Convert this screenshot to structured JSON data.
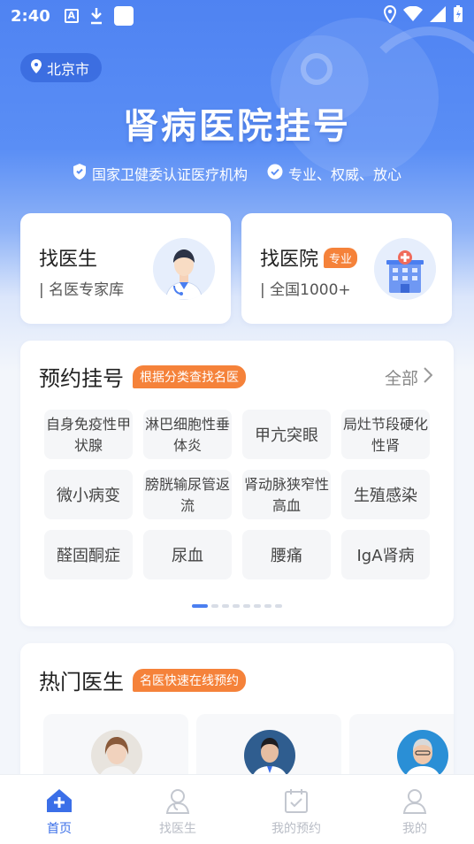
{
  "status_bar": {
    "time": "2:40"
  },
  "location": {
    "city": "北京市"
  },
  "hero": {
    "title": "肾病医院挂号",
    "tags": [
      "国家卫健委认证医疗机构",
      "专业、权威、放心"
    ]
  },
  "quick_cards": [
    {
      "title": "找医生",
      "subtitle": "| 名医专家库",
      "badge": ""
    },
    {
      "title": "找医院",
      "subtitle": "| 全国1000+",
      "badge": "专业"
    }
  ],
  "appointment": {
    "title": "预约挂号",
    "badge": "根据分类查找名医",
    "more": "全部",
    "categories": [
      "自身免疫性甲状腺",
      "淋巴细胞性垂体炎",
      "甲亢突眼",
      "局灶节段硬化性肾",
      "微小病变",
      "膀胱输尿管返流",
      "肾动脉狭窄性高血",
      "生殖感染",
      "醛固酮症",
      "尿血",
      "腰痛",
      "IgA肾病"
    ],
    "page_count": 8,
    "active_page": 1
  },
  "hot_doctors": {
    "title": "热门医生",
    "badge": "名医快速在线预约"
  },
  "tab_bar": {
    "tabs": [
      "首页",
      "找医生",
      "我的预约",
      "我的"
    ],
    "active_index": 0
  },
  "colors": {
    "primary": "#3b6fe8",
    "accent": "#f5823a"
  }
}
